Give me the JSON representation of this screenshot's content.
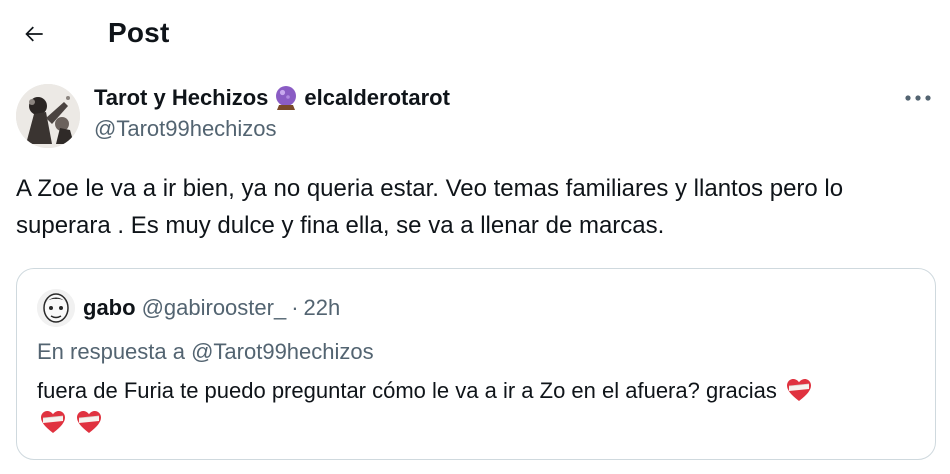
{
  "header": {
    "title": "Post",
    "back_icon": "arrow-left-icon"
  },
  "post": {
    "author_name": "Tarot y Hechizos",
    "author_name_suffix": "elcalderotarot",
    "author_emoji": "crystal-ball-icon",
    "handle": "@Tarot99hechizos",
    "text": "A Zoe le va a ir bien, ya no queria estar. Veo temas familiares y llantos pero lo superara . Es muy dulce y fina ella, se va a llenar de marcas.",
    "more_icon": "more-horizontal-icon"
  },
  "quote": {
    "name": "gabo",
    "handle": "@gabirooster_",
    "separator": "·",
    "time": "22h",
    "reply_to": "En respuesta a @Tarot99hechizos",
    "text": "fuera de Furia te puedo preguntar cómo le va a ir a Zo en el afuera? gracias",
    "emoji": "mending-heart-icon",
    "emoji_count": 3
  },
  "colors": {
    "text_primary": "#0f1419",
    "text_secondary": "#536471",
    "border": "#cfd9de",
    "crystal_ball": "#8a5cc4",
    "heart_red": "#e0323f"
  }
}
